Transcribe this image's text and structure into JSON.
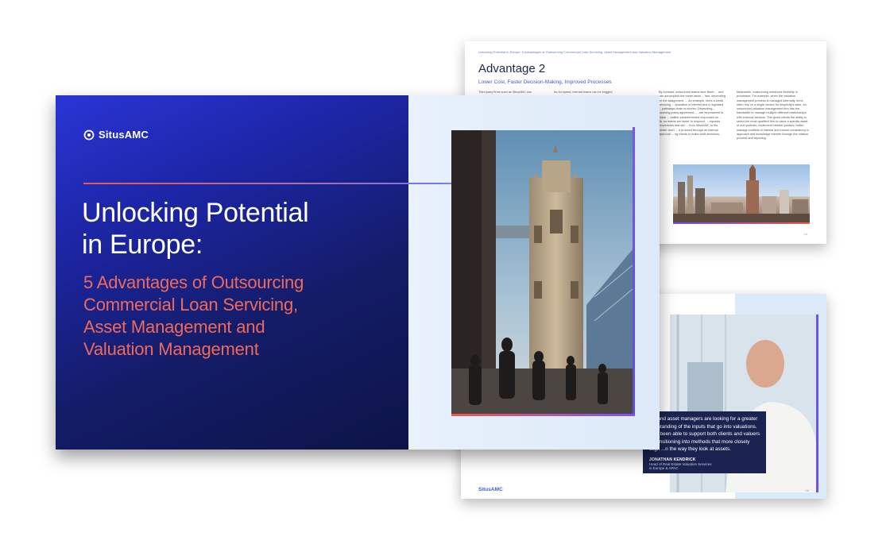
{
  "page2": {
    "breadcrumb": "Unlocking Potential in Europe: 5 Advantages of Outsourcing Commercial Loan Servicing, Asset Management and Valuation Management",
    "title": "Advantage 2",
    "subtitle": "Lower Cost, Faster Decision-Making, Improved Processes",
    "col1": "Third-party firms such as SitusAMC can",
    "col2": "As for speed, internal teams can be bogged",
    "col3": "By contrast, outsourced teams face fewer ... and can accomplish the same tasks ... fast, depending on the assignment. ... An example, hires a credit servicing ... eparation of interest and a regulated ... pathways chain is shorter. Depending ... sourcing policy agreement, ... are empowered to make ... estline predetermined responses on ... ds, so teams are faster to respond. ... equests procedures that are ... from SitusAMC to the lender don't ... d proceed through an internal approval ... ng clients to make swift decisions.",
    "col4": "Meanwhile, outsourcing enhances flexibility in processes. For example, when the valuation management process is managed internally, firms often rely on a single vendor for simplicity's sake. An outsourced valuation management firm has the bandwidth to manage multiple different relationships with external vendors. This gives clients the ability to select the most qualified firm to value a specific asset or sub-portfolio, implement rotation policies, better manage conflicts of interest and ensure consistency in approach and knowledge transfer through the rotation process and reporting.",
    "page_number": "04"
  },
  "page3": {
    "quote": "...d and asset managers are looking for a greater ...erstanding of the inputs that go into valuations. ...ve been able to support both clients and valuers ...transitioning into methods that more closely align ...n the way they look at assets.",
    "name": "JONATHAN KENDRICK",
    "role_line1": "Head of Real Estate Valuation Services",
    "role_line2": "in Europe & APAC",
    "logo": "SitusAMC",
    "page_number": "06"
  },
  "cover": {
    "logo_text": "SitusAMC",
    "title_line1": "Unlocking Potential",
    "title_line2": "in Europe:",
    "subtitle_line1": "5 Advantages of Outsourcing",
    "subtitle_line2": "Commercial Loan Servicing,",
    "subtitle_line3": "Asset Management and",
    "subtitle_line4": "Valuation Management"
  },
  "icons": {
    "logo": "situsamc-logo-icon",
    "tower_photo": "tower-bridge-photo",
    "city_photo": "city-skyline-photo",
    "portrait_photo": "portrait-photo"
  },
  "colors": {
    "cover_blue": "#1d26a8",
    "cover_navy": "#0d1447",
    "accent_coral": "#f06a5a",
    "accent_violet": "#6b53f2",
    "quote_navy": "#1b2350"
  }
}
